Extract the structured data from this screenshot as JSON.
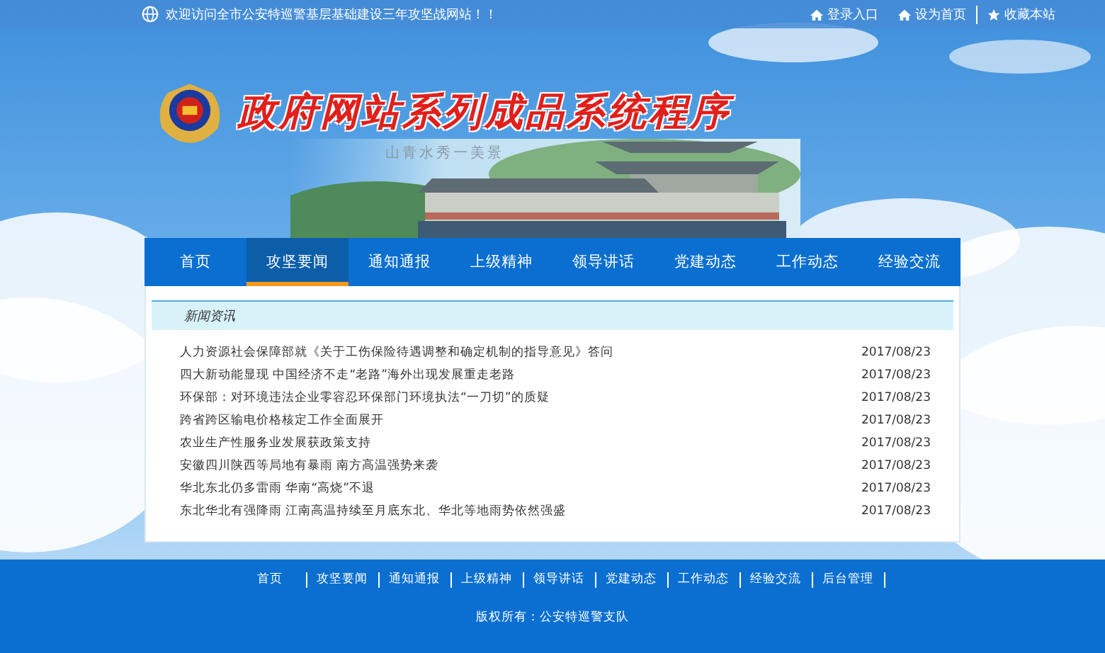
{
  "top_bar": {
    "welcome": "欢迎访问全市公安特巡警基层基础建设三年攻坚战网站！！",
    "links": [
      {
        "label": "登录入口",
        "kind": "home"
      },
      {
        "label": "设为首页",
        "kind": "home"
      },
      {
        "label": "收藏本站",
        "kind": "star"
      }
    ]
  },
  "banner": {
    "title": "政府网站系列成品系统程序",
    "subtitle": "山青水秀一美景"
  },
  "nav": [
    {
      "label": "首页",
      "selected": false
    },
    {
      "label": "攻坚要闻",
      "selected": true
    },
    {
      "label": "通知通报",
      "selected": false
    },
    {
      "label": "上级精神",
      "selected": false
    },
    {
      "label": "领导讲话",
      "selected": false
    },
    {
      "label": "党建动态",
      "selected": false
    },
    {
      "label": "工作动态",
      "selected": false
    },
    {
      "label": "经验交流",
      "selected": false
    }
  ],
  "news": {
    "heading": "新闻资讯",
    "items": [
      {
        "title": "人力资源社会保障部就《关于工伤保险待遇调整和确定机制的指导意见》答问",
        "date": "2017/08/23"
      },
      {
        "title": "四大新动能显现 中国经济不走“老路”海外出现发展重走老路",
        "date": "2017/08/23"
      },
      {
        "title": "环保部：对环境违法企业零容忍环保部门环境执法“一刀切”的质疑",
        "date": "2017/08/23"
      },
      {
        "title": "跨省跨区输电价格核定工作全面展开",
        "date": "2017/08/23"
      },
      {
        "title": "农业生产性服务业发展获政策支持",
        "date": "2017/08/23"
      },
      {
        "title": "安徽四川陕西等局地有暴雨 南方高温强势来袭",
        "date": "2017/08/23"
      },
      {
        "title": "华北东北仍多雷雨 华南“高烧”不退",
        "date": "2017/08/23"
      },
      {
        "title": "东北华北有强降雨 江南高温持续至月底东北、华北等地雨势依然强盛",
        "date": "2017/08/23"
      }
    ]
  },
  "footer": {
    "links": [
      "首页",
      "攻坚要闻",
      "通知通报",
      "上级精神",
      "领导讲话",
      "党建动态",
      "工作动态",
      "经验交流",
      "后台管理"
    ],
    "copyright": "版权所有：公安特巡警支队"
  }
}
